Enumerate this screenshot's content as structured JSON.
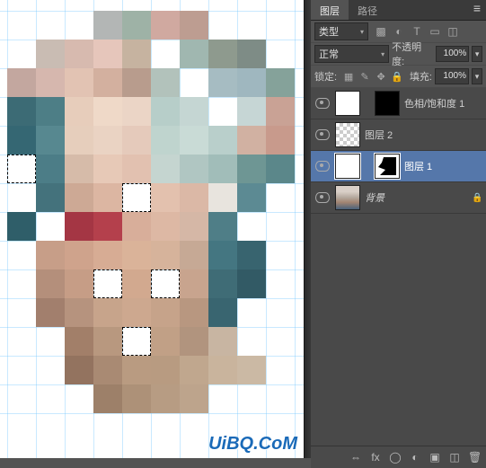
{
  "watermark": "UiBQ.CoM",
  "panel": {
    "tabs": {
      "layers": "图层",
      "paths": "路径"
    },
    "kind_label": "类型",
    "blend_mode": "正常",
    "opacity_label": "不透明度:",
    "opacity_value": "100%",
    "lock_label": "锁定:",
    "fill_label": "填充:",
    "fill_value": "100%",
    "layers": {
      "hue_sat": "色相/饱和度 1",
      "layer2": "图层 2",
      "layer1": "图层 1",
      "background": "背景"
    }
  }
}
